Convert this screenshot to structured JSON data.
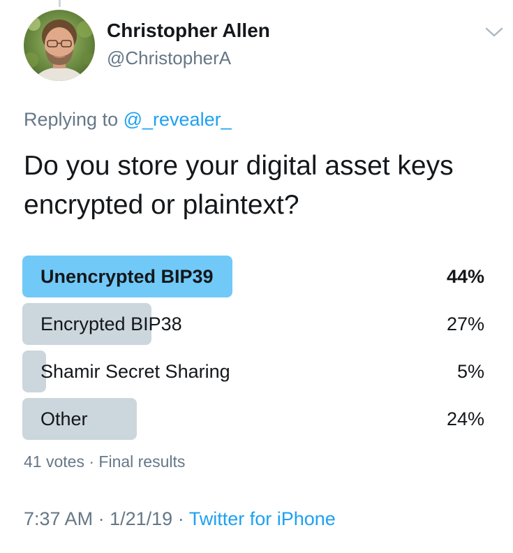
{
  "author": {
    "name": "Christopher Allen",
    "handle": "@ChristopherA"
  },
  "reply": {
    "prefix": "Replying to",
    "mention": "@_revealer_"
  },
  "tweet": {
    "text": "Do you store your digital asset keys encrypted or plaintext?"
  },
  "poll": {
    "options": [
      {
        "label": "Unencrypted BIP39",
        "percent_label": "44%",
        "percent": 44,
        "winner": true
      },
      {
        "label": "Encrypted BIP38",
        "percent_label": "27%",
        "percent": 27,
        "winner": false
      },
      {
        "label": "Shamir Secret Sharing",
        "percent_label": "5%",
        "percent": 5,
        "winner": false
      },
      {
        "label": "Other",
        "percent_label": "24%",
        "percent": 24,
        "winner": false
      }
    ],
    "votes": "41 votes",
    "separator": "·",
    "status": "Final results"
  },
  "meta": {
    "time": "7:37 AM",
    "date": "1/21/19",
    "separator": "·",
    "source": "Twitter for iPhone"
  },
  "colors": {
    "winner_bar": "#71c9f8",
    "bar": "#ccd6dd",
    "link": "#1da1f2",
    "muted": "#657786"
  },
  "icons": {
    "menu": "chevron-down-icon",
    "avatar": "avatar-photo"
  }
}
